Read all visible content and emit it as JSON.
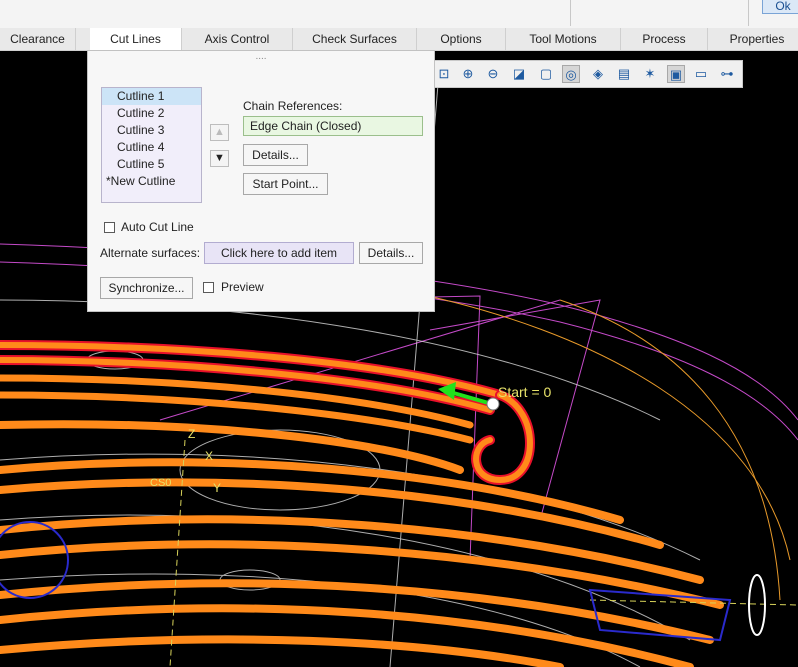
{
  "ok_label": "Ok",
  "tabs": [
    {
      "label": "Clearance"
    },
    {
      "label": "Cut Lines"
    },
    {
      "label": "Axis Control"
    },
    {
      "label": "Check Surfaces"
    },
    {
      "label": "Options"
    },
    {
      "label": "Tool Motions"
    },
    {
      "label": "Process"
    },
    {
      "label": "Properties"
    }
  ],
  "active_tab": "Cut Lines",
  "panel": {
    "grip": "....",
    "cutlines": [
      "Cutline 1",
      "Cutline 2",
      "Cutline 3",
      "Cutline 4",
      "Cutline 5",
      "*New Cutline"
    ],
    "selected_cutline": "Cutline 1",
    "chain_references_label": "Chain References:",
    "chain_value": "Edge Chain (Closed)",
    "details_label": "Details...",
    "start_point_label": "Start Point...",
    "auto_cut_line_label": "Auto Cut Line",
    "auto_cut_line_checked": false,
    "alternate_surfaces_label": "Alternate surfaces:",
    "alternate_placeholder": "Click here to add item",
    "alternate_details_label": "Details...",
    "synchronize_label": "Synchronize...",
    "preview_label": "Preview",
    "preview_checked": false
  },
  "viewport": {
    "start_label": "Start = 0",
    "axis_z": "Z",
    "axis_x": "X",
    "axis_y": "Y",
    "csys_label": "CS0"
  },
  "view_toolbar_icons": [
    "zoom-window-icon",
    "zoom-in-icon",
    "zoom-out-icon",
    "refit-icon",
    "view-orient-icon",
    "spin-center-icon",
    "display-style-icon",
    "saved-views-icon",
    "datum-display-icon",
    "annotation-display-icon",
    "section-icon",
    "hide-icon",
    "network-icon"
  ],
  "colors": {
    "toolpath": "#ff8a1a",
    "toolpath_edge": "#e8102a",
    "outline": "#c44ac8",
    "start_arrow": "#22e21b",
    "start_text": "#e8e36a",
    "highlight_field": "#e9f7e2"
  }
}
